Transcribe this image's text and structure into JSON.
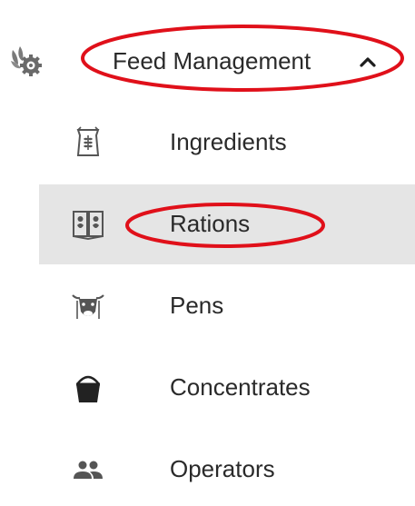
{
  "section": {
    "label": "Feed Management",
    "icon": "gear-leaf-icon",
    "expanded": true
  },
  "items": [
    {
      "label": "Ingredients",
      "icon": "feed-sack-icon",
      "active": false
    },
    {
      "label": "Rations",
      "icon": "ration-book-icon",
      "active": true
    },
    {
      "label": "Pens",
      "icon": "cow-head-icon",
      "active": false
    },
    {
      "label": "Concentrates",
      "icon": "bucket-icon",
      "active": false
    },
    {
      "label": "Operators",
      "icon": "people-icon",
      "active": false
    }
  ],
  "colors": {
    "text": "#2a2a2a",
    "active_background": "#e5e5e5",
    "icon": "#555555",
    "annotation": "#e0101a"
  }
}
